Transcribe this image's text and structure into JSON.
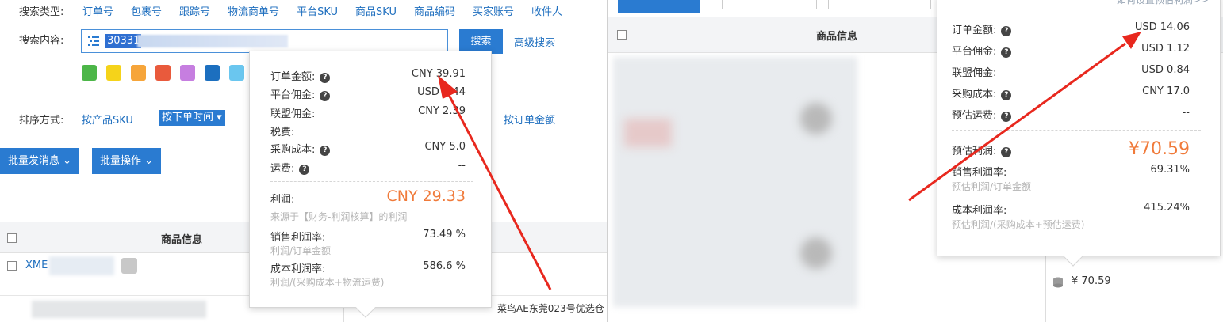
{
  "left": {
    "search_type_label": "搜索类型:",
    "search_types": [
      "订单号",
      "包裹号",
      "跟踪号",
      "物流商单号",
      "平台SKU",
      "商品SKU",
      "商品编码",
      "买家账号",
      "收件人"
    ],
    "search_content_label": "搜索内容:",
    "search_value": "30331",
    "search_button": "搜索",
    "advanced_search": "高级搜索",
    "swatch_colors": [
      "#4cb648",
      "#f5d31a",
      "#f6a53a",
      "#e95a3c",
      "#c67ee0",
      "#1c6fbf",
      "#6ac6ef"
    ],
    "sort_label": "排序方式:",
    "sort_by_sku": "按产品SKU",
    "sort_by_time": "按下单时间",
    "sort_by_amount": "按订单金额",
    "bulk_message": "批量发消息",
    "bulk_action": "批量操作",
    "header_product_info": "商品信息",
    "row_sku_prefix": "XME",
    "footer_text": "菜鸟AE东莞023号优选仓",
    "popover": {
      "order_amount_label": "订单金额:",
      "order_amount": "CNY 39.91",
      "platform_fee_label": "平台佣金:",
      "platform_fee": "USD 0.44",
      "affiliate_fee_label": "联盟佣金:",
      "affiliate_fee": "CNY 2.39",
      "tax_label": "税费:",
      "purchase_cost_label": "采购成本:",
      "purchase_cost": "CNY 5.0",
      "shipping_label": "运费:",
      "shipping": "--",
      "profit_label": "利润:",
      "profit": "CNY 29.33",
      "profit_note": "来源于【财务-利润核算】的利润",
      "sales_margin_label": "销售利润率:",
      "sales_margin": "73.49 %",
      "sales_margin_note": "利润/订单金额",
      "cost_margin_label": "成本利润率:",
      "cost_margin": "586.6 %",
      "cost_margin_note": "利润/(采购成本+物流运费)"
    }
  },
  "right": {
    "top_link": "如何设置预估利润>>",
    "header_product_info": "商品信息",
    "bottom_profit": "¥ 70.59",
    "popover": {
      "order_amount_label": "订单金额:",
      "order_amount": "USD 14.06",
      "platform_fee_label": "平台佣金:",
      "platform_fee": "USD 1.12",
      "affiliate_fee_label": "联盟佣金:",
      "affiliate_fee": "USD 0.84",
      "purchase_cost_label": "采购成本:",
      "purchase_cost": "CNY 17.0",
      "est_shipping_label": "预估运费:",
      "est_shipping": "--",
      "est_profit_label": "预估利润:",
      "est_profit": "¥70.59",
      "sales_margin_label": "销售利润率:",
      "sales_margin": "69.31%",
      "sales_margin_note": "预估利润/订单金额",
      "cost_margin_label": "成本利润率:",
      "cost_margin": "415.24%",
      "cost_margin_note": "预估利润/(采购成本+预估运费)"
    }
  },
  "colors": {
    "primary": "#2a7bd1",
    "link": "#1f6fbf",
    "profit": "#f07a3a",
    "annotation_arrow": "#e8281e"
  }
}
